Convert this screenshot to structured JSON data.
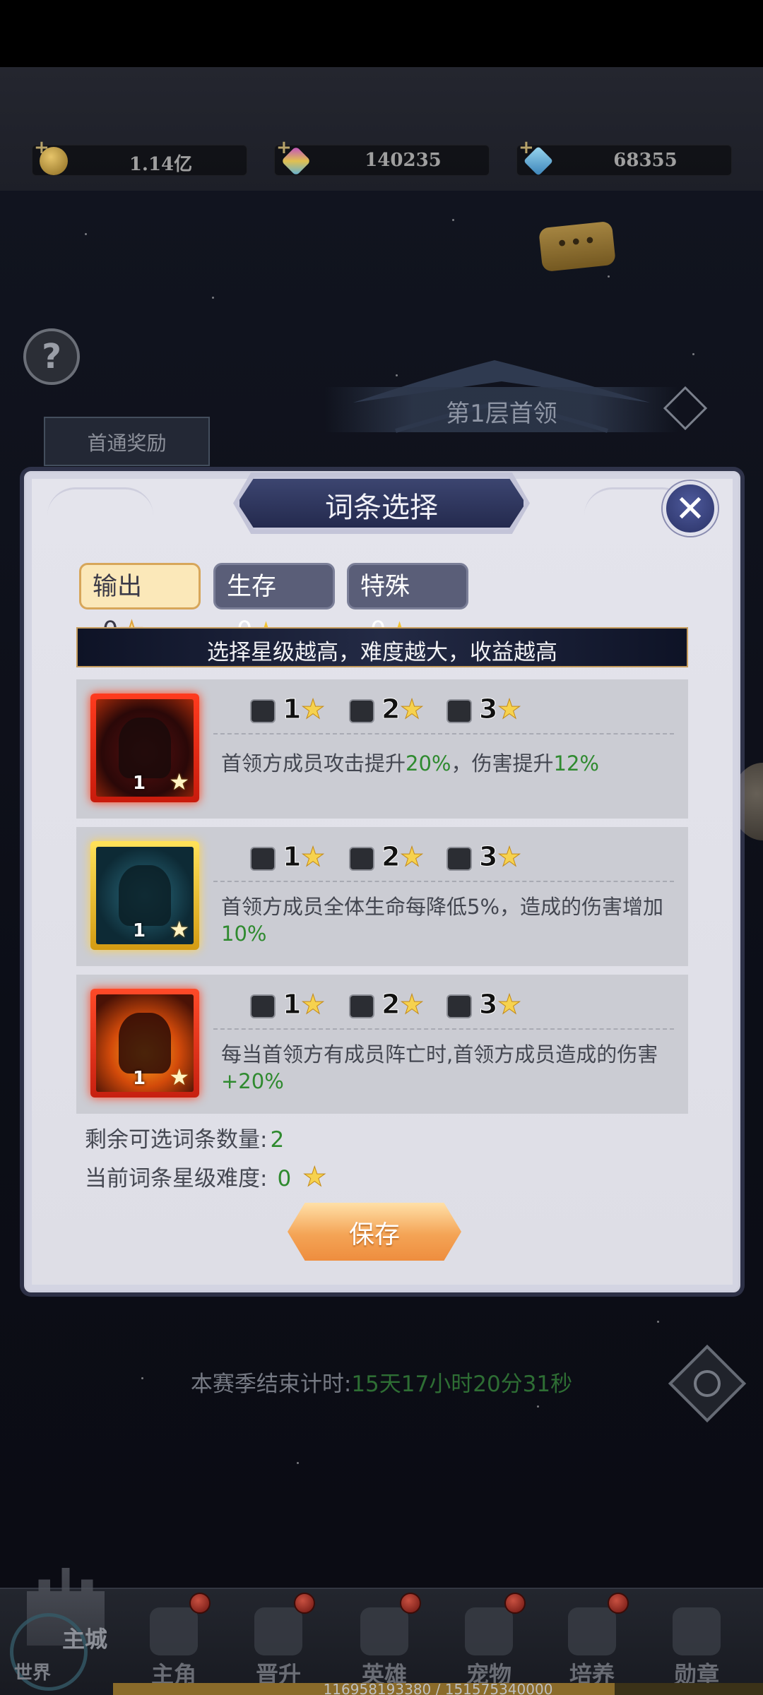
{
  "currencies": [
    {
      "icon": "gold-coin-icon",
      "value": "1.14亿"
    },
    {
      "icon": "gem-icon",
      "value": "140235"
    },
    {
      "icon": "diamond-icon",
      "value": "68355"
    }
  ],
  "help_label": "?",
  "chat_label": "•••",
  "boss_title": "第1层首领",
  "first_clear_tab": "首通奖励",
  "season": {
    "label": "本赛季结束计时:",
    "time": "15天17小时20分31秒"
  },
  "modal": {
    "title": "词条选择",
    "close_label": "✕",
    "tabs": [
      {
        "label": "输出",
        "count": "0",
        "active": true
      },
      {
        "label": "生存",
        "count": "0",
        "active": false
      },
      {
        "label": "特殊",
        "count": "0",
        "active": false
      }
    ],
    "banner": "选择星级越高，难度越大，收益越高",
    "rows": [
      {
        "icon_level": "1",
        "levels": [
          "1",
          "2",
          "3"
        ],
        "desc_a": "首领方成员攻击提升",
        "desc_b": "20%",
        "desc_c": "，伤害提升",
        "desc_d": "12%"
      },
      {
        "icon_level": "1",
        "levels": [
          "1",
          "2",
          "3"
        ],
        "desc_a": "首领方成员全体生命每降低5%，造成的伤害增加",
        "desc_b": "10%"
      },
      {
        "icon_level": "1",
        "levels": [
          "1",
          "2",
          "3"
        ],
        "desc_a": "每当首领方有成员阵亡时,首领方成员造成的伤害",
        "desc_b": "+20%"
      }
    ],
    "remaining_label": "剩余可选词条数量:",
    "remaining_value": "2",
    "difficulty_label": "当前词条星级难度:",
    "difficulty_value": "0",
    "save_label": "保存"
  },
  "nav": {
    "world_main": "主城",
    "world_sub": "世界",
    "items": [
      {
        "label": "主角",
        "badge": true
      },
      {
        "label": "晋升",
        "badge": true
      },
      {
        "label": "英雄",
        "badge": true
      },
      {
        "label": "宠物",
        "badge": true
      },
      {
        "label": "培养",
        "badge": true
      },
      {
        "label": "勋章",
        "badge": false
      }
    ]
  },
  "exp": {
    "text": "116958193380 / 151575340000",
    "fraction": 0.772
  }
}
